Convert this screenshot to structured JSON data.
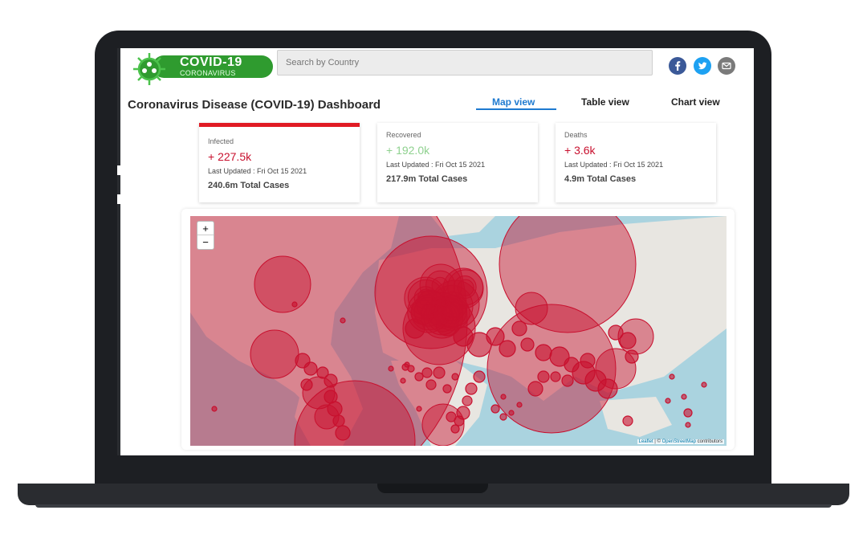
{
  "header": {
    "logo_title": "COVID-19",
    "logo_subtitle": "CORONAVIRUS",
    "search_placeholder": "Search by Country",
    "social_icons": [
      "facebook-icon",
      "twitter-icon",
      "mail-icon"
    ]
  },
  "dashboard": {
    "title": "Coronavirus Disease (COVID-19) Dashboard",
    "tabs": [
      {
        "label": "Map view",
        "active": true
      },
      {
        "label": "Table view",
        "active": false
      },
      {
        "label": "Chart view",
        "active": false
      }
    ]
  },
  "stats": [
    {
      "label": "Infected",
      "delta": "+ 227.5k",
      "updated": "Last Updated : Fri Oct 15 2021",
      "total": "240.6m Total Cases",
      "color": "#c8102e"
    },
    {
      "label": "Recovered",
      "delta": "+ 192.0k",
      "updated": "Last Updated : Fri Oct 15 2021",
      "total": "217.9m Total Cases",
      "color": "#8fd18f"
    },
    {
      "label": "Deaths",
      "delta": "+ 3.6k",
      "updated": "Last Updated : Fri Oct 15 2021",
      "total": "4.9m Total Cases",
      "color": "#c8102e"
    }
  ],
  "map": {
    "zoom_in": "+",
    "zoom_out": "−",
    "attribution_leaflet": "Leaflet",
    "attribution_sep": " | © ",
    "attribution_osm": "OpenStreetMap",
    "attribution_tail": " contributors",
    "bubble_color": "#c8102e",
    "water_color": "#aad3df",
    "land_color": "#e8e6e1"
  },
  "colors": {
    "accent": "#1e7ad0",
    "brand_green": "#2f9b2f",
    "infected_bar": "#e01b24"
  }
}
